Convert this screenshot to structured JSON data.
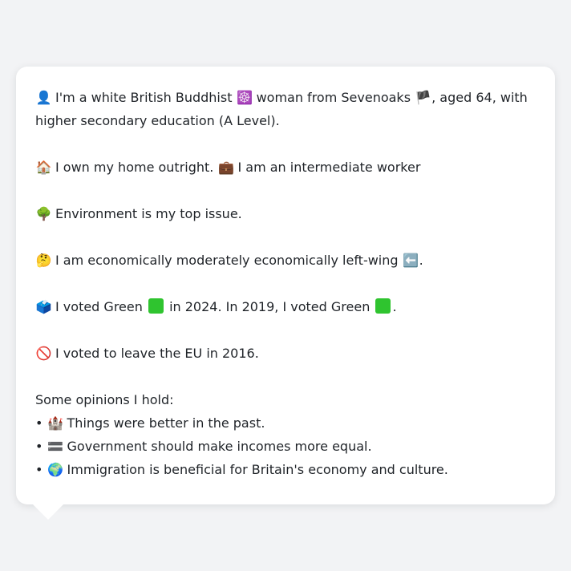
{
  "profile": {
    "p1": {
      "icon": "👤",
      "a": "I'm a white British Buddhist",
      "icon2": "☸️",
      "b": "woman from Sevenoaks",
      "icon3": "🏴",
      "c": ", aged 64, with higher secondary education (A Level)."
    },
    "p2": {
      "icon": "🏠",
      "a": "I own my home outright.",
      "icon2": "💼",
      "b": "I am an intermediate worker"
    },
    "p3": {
      "icon": "🌳",
      "a": "Environment is my top issue."
    },
    "p4": {
      "icon": "🤔",
      "a": "I am economically moderately economically left-wing",
      "icon2": "⬅️",
      "b": "."
    },
    "p5": {
      "icon": "🗳️",
      "a": "I voted Green",
      "b": "in 2024. In 2019, I voted Green",
      "c": ".",
      "green": "#2fc42f"
    },
    "p6": {
      "icon": "🚫",
      "a": "I voted to leave the EU in 2016."
    },
    "opinions": {
      "heading": "Some opinions I hold:",
      "bullet": "•",
      "items": [
        {
          "icon": "🏰",
          "text": "Things were better in the past."
        },
        {
          "icon": "🟰",
          "text": "Government should make incomes more equal."
        },
        {
          "icon": "🌍",
          "text": "Immigration is beneficial for Britain's economy and culture."
        }
      ]
    }
  }
}
